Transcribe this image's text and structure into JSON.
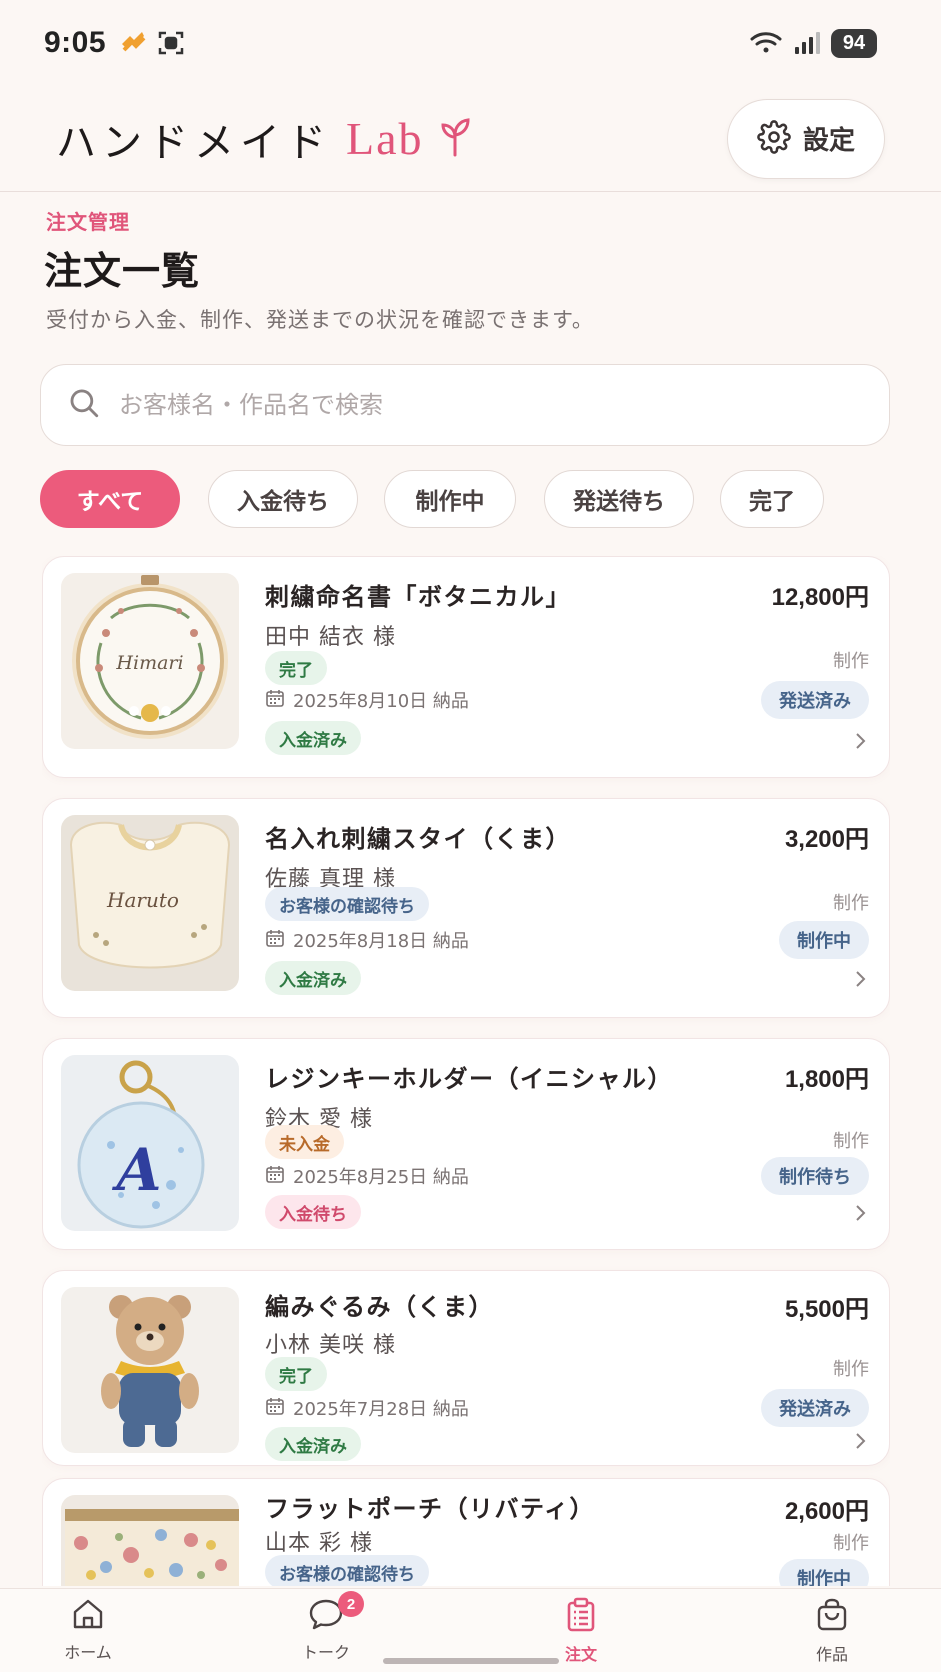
{
  "status_bar": {
    "time": "9:05",
    "battery": "94"
  },
  "header": {
    "logo_text": "ハンドメイド",
    "logo_accent": "Lab",
    "settings_label": "設定"
  },
  "page": {
    "breadcrumb": "注文管理",
    "title": "注文一覧",
    "subtitle": "受付から入金、制作、発送までの状況を確認できます。"
  },
  "search": {
    "placeholder": "お客様名・作品名で検索"
  },
  "filters": [
    "すべて",
    "入金待ち",
    "制作中",
    "発送待ち",
    "完了"
  ],
  "active_filter": "すべて",
  "orders": [
    {
      "name": "刺繍命名書「ボタニカル」",
      "customer": "田中 結衣 様",
      "status": "完了",
      "delivery": "2025年8月10日 納品",
      "payment": "入金済み",
      "price": "12,800円",
      "production_label": "制作",
      "production_status": "発送済み"
    },
    {
      "name": "名入れ刺繍スタイ（くま）",
      "customer": "佐藤 真理 様",
      "status": "お客様の確認待ち",
      "delivery": "2025年8月18日 納品",
      "payment": "入金済み",
      "price": "3,200円",
      "production_label": "制作",
      "production_status": "制作中"
    },
    {
      "name": "レジンキーホルダー（イニシャル）",
      "customer": "鈴木 愛 様",
      "status": "未入金",
      "delivery": "2025年8月25日 納品",
      "payment": "入金待ち",
      "price": "1,800円",
      "production_label": "制作",
      "production_status": "制作待ち"
    },
    {
      "name": "編みぐるみ（くま）",
      "customer": "小林 美咲 様",
      "status": "完了",
      "delivery": "2025年7月28日 納品",
      "payment": "入金済み",
      "price": "5,500円",
      "production_label": "制作",
      "production_status": "発送済み"
    },
    {
      "name": "フラットポーチ（リバティ）",
      "customer": "山本 彩 様",
      "status": "お客様の確認待ち",
      "price": "2,600円",
      "production_label": "制作",
      "production_status": "制作中"
    }
  ],
  "thumb_texts": {
    "hoop": "Himari",
    "bib": "Haruto",
    "keychain": "A"
  },
  "bottom_nav": [
    {
      "label": "ホーム",
      "icon": "home-icon"
    },
    {
      "label": "トーク",
      "icon": "chat-icon",
      "badge": "2"
    },
    {
      "label": "注文",
      "icon": "clipboard-icon"
    },
    {
      "label": "作品",
      "icon": "bag-icon"
    }
  ],
  "colors": {
    "accent": "#ec5b7c",
    "background": "#fcf7f4"
  }
}
